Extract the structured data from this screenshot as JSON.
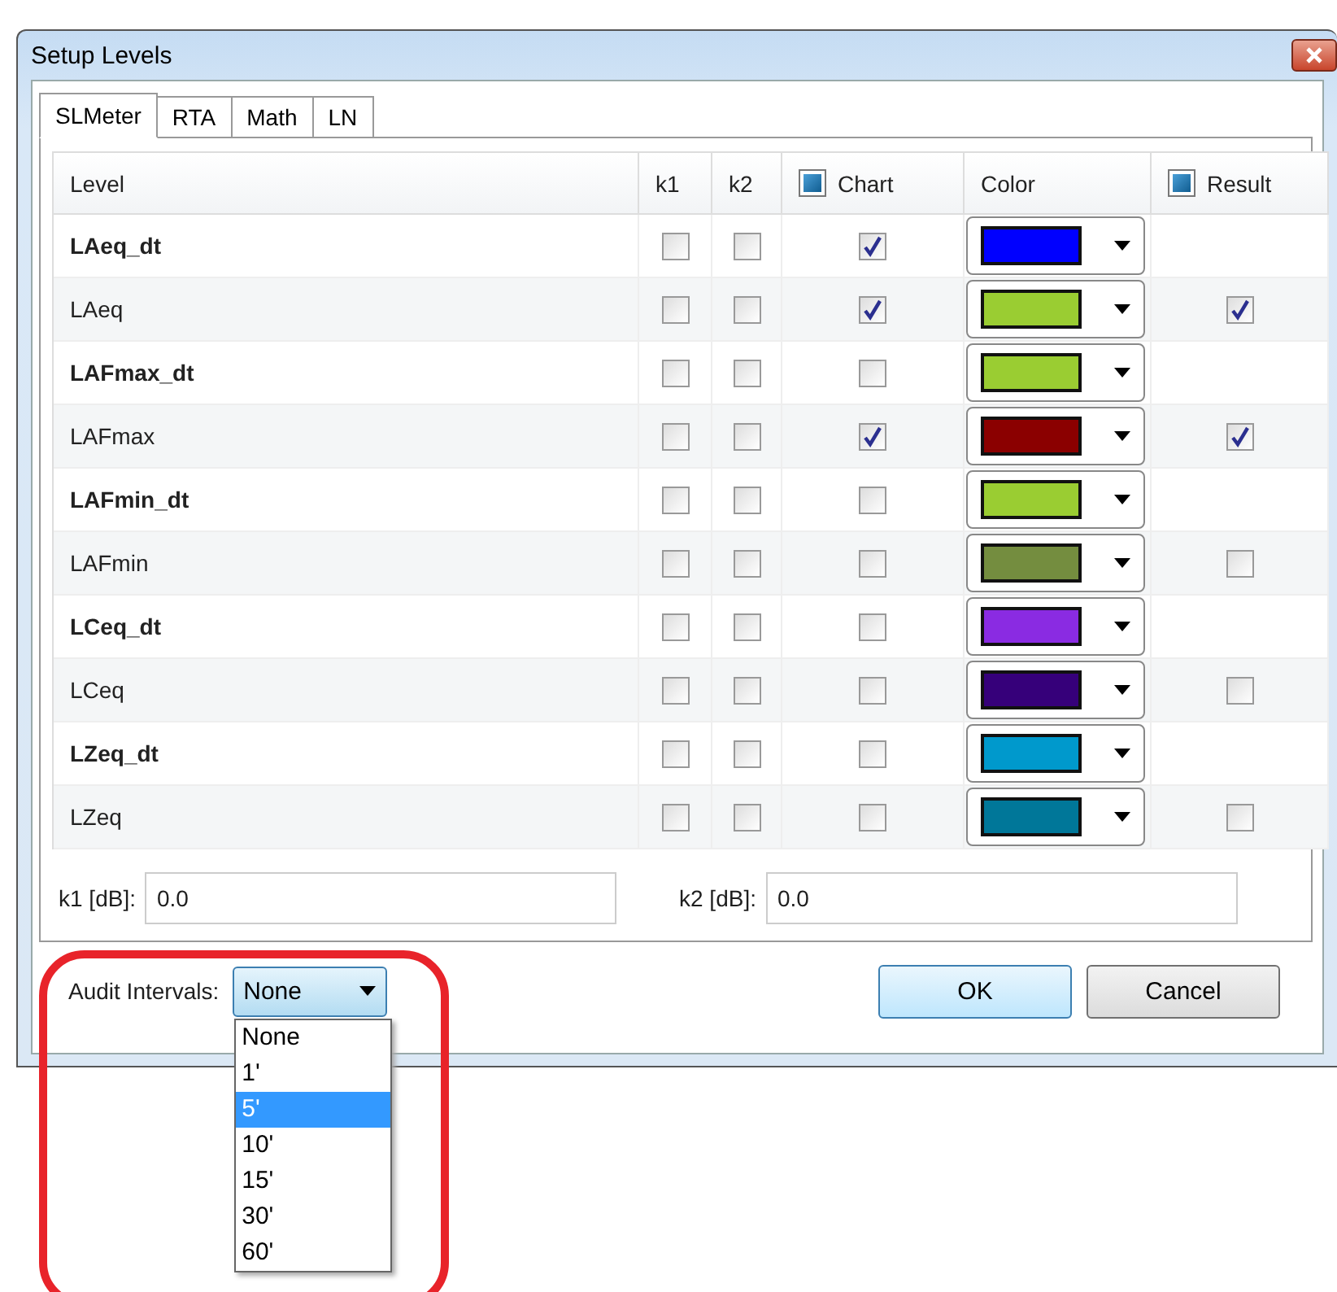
{
  "window": {
    "title": "Setup Levels"
  },
  "tabs": [
    {
      "label": "SLMeter",
      "selected": true
    },
    {
      "label": "RTA",
      "selected": false
    },
    {
      "label": "Math",
      "selected": false
    },
    {
      "label": "LN",
      "selected": false
    }
  ],
  "columns": [
    {
      "label": "Level",
      "kind": "text"
    },
    {
      "label": "k1",
      "kind": "text"
    },
    {
      "label": "k2",
      "kind": "text"
    },
    {
      "label": "Chart",
      "kind": "checkbox",
      "indeterminate": true
    },
    {
      "label": "Color",
      "kind": "text"
    },
    {
      "label": "Result",
      "kind": "checkbox",
      "indeterminate": true
    }
  ],
  "rows": [
    {
      "level": "LAeq_dt",
      "bold": true,
      "k1": false,
      "k2": false,
      "chart": true,
      "color": "#0000ff"
    },
    {
      "level": "LAeq",
      "bold": false,
      "k1": false,
      "k2": false,
      "chart": true,
      "color": "#9acd32",
      "result": true
    },
    {
      "level": "LAFmax_dt",
      "bold": true,
      "k1": false,
      "k2": false,
      "chart": false,
      "color": "#9acd32"
    },
    {
      "level": "LAFmax",
      "bold": false,
      "k1": false,
      "k2": false,
      "chart": true,
      "color": "#8b0000",
      "result": true
    },
    {
      "level": "LAFmin_dt",
      "bold": true,
      "k1": false,
      "k2": false,
      "chart": false,
      "color": "#9acd32"
    },
    {
      "level": "LAFmin",
      "bold": false,
      "k1": false,
      "k2": false,
      "chart": false,
      "color": "#748d3f",
      "result": false
    },
    {
      "level": "LCeq_dt",
      "bold": true,
      "k1": false,
      "k2": false,
      "chart": false,
      "color": "#8a2be2"
    },
    {
      "level": "LCeq",
      "bold": false,
      "k1": false,
      "k2": false,
      "chart": false,
      "color": "#36007a",
      "result": false
    },
    {
      "level": "LZeq_dt",
      "bold": true,
      "k1": false,
      "k2": false,
      "chart": false,
      "color": "#0099cc"
    },
    {
      "level": "LZeq",
      "bold": false,
      "k1": false,
      "k2": false,
      "chart": false,
      "color": "#007799",
      "result": false
    }
  ],
  "k_fields": [
    {
      "label": "k1 [dB]:",
      "value": "0.0"
    },
    {
      "label": "k2 [dB]:",
      "value": "0.0"
    }
  ],
  "audit_intervals": {
    "label": "Audit Intervals:",
    "value": "None",
    "expanded": true,
    "options": [
      {
        "label": "None",
        "highlighted": false
      },
      {
        "label": "1'",
        "highlighted": false
      },
      {
        "label": "5'",
        "highlighted": true
      },
      {
        "label": "10'",
        "highlighted": false
      },
      {
        "label": "15'",
        "highlighted": false
      },
      {
        "label": "30'",
        "highlighted": false
      },
      {
        "label": "60'",
        "highlighted": false
      }
    ]
  },
  "buttons": [
    {
      "label": "OK",
      "default": true
    },
    {
      "label": "Cancel",
      "default": false
    }
  ]
}
